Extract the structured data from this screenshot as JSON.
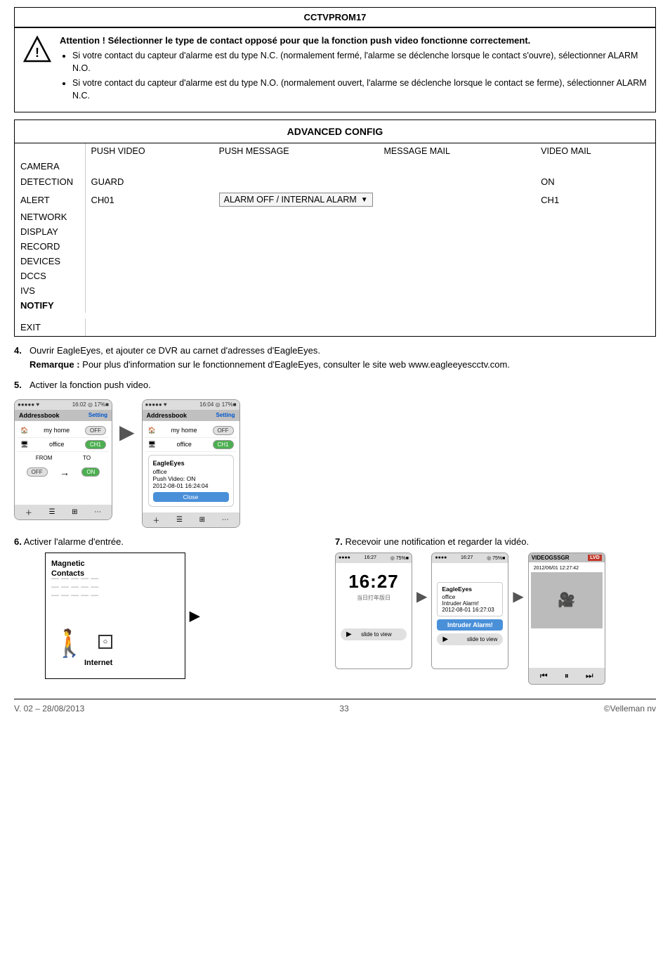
{
  "header": {
    "title": "CCTVPROM17"
  },
  "warning": {
    "title": "Attention ! Sélectionner le type de contact opposé pour que la fonction push video fonctionne correctement.",
    "bullets": [
      "Si votre contact du capteur d'alarme est du type N.C. (normalement fermé, l'alarme se déclenche lorsque le contact s'ouvre), sélectionner ALARM N.O.",
      "Si votre contact du capteur d'alarme est du type N.O. (normalement ouvert, l'alarme se déclenche lorsque le contact se ferme), sélectionner ALARM N.C."
    ]
  },
  "config": {
    "title": "ADVANCED CONFIG",
    "sidebar": [
      {
        "label": "CAMERA",
        "bold": false
      },
      {
        "label": "DETECTION",
        "bold": false
      },
      {
        "label": "ALERT",
        "bold": false
      },
      {
        "label": "NETWORK",
        "bold": false
      },
      {
        "label": "DISPLAY",
        "bold": false
      },
      {
        "label": "RECORD",
        "bold": false
      },
      {
        "label": "DEVICES",
        "bold": false
      },
      {
        "label": "DCCS",
        "bold": false
      },
      {
        "label": "IVS",
        "bold": false
      },
      {
        "label": "NOTIFY",
        "bold": true
      }
    ],
    "columns": [
      "PUSH VIDEO",
      "PUSH MESSAGE",
      "MESSAGE MAIL",
      "VIDEO MAIL"
    ],
    "guard_label": "GUARD",
    "guard_on": "ON",
    "ch01_label": "CH01",
    "alarm_select": "ALARM OFF / INTERNAL ALARM",
    "ch1_label": "CH1",
    "exit_label": "EXIT"
  },
  "steps": {
    "step4": {
      "num": "4.",
      "text": "Ouvrir EagleEyes, et ajouter ce DVR au carnet d'adresses d'EagleEyes.",
      "remark_label": "Remarque :",
      "remark_text": "Pour plus d'information sur le fonctionnement d'EagleEyes, consulter le site web www.eagleeyescctv.com."
    },
    "step5": {
      "num": "5.",
      "text": "Activer la fonction push video."
    }
  },
  "phones_step5": {
    "phone1": {
      "status_left": "●●●●● ♥",
      "status_right": "16:02  ◎ 17%■",
      "nav_title": "Addressbook",
      "nav_btn": "Setting",
      "items": [
        {
          "icon": "🏠",
          "label": "my home",
          "toggle": "OFF",
          "toggle_state": "off"
        },
        {
          "icon": "🖥",
          "label": "office",
          "toggle": "CH1",
          "toggle_state": "on"
        }
      ],
      "from_label": "FROM",
      "to_label": "TO",
      "from_toggle": "OFF",
      "to_toggle": "ON"
    },
    "phone2": {
      "status_left": "●●●●● ♥",
      "status_right": "16:04  ◎ 17%■",
      "nav_title": "Addressbook",
      "nav_btn": "Setting",
      "items": [
        {
          "icon": "🏠",
          "label": "my home",
          "toggle": "OFF",
          "toggle_state": "off"
        },
        {
          "icon": "🖥",
          "label": "office",
          "toggle": "CH1",
          "toggle_state": "on"
        }
      ],
      "popup": {
        "title": "EagleEyes",
        "line1": "office",
        "line2": "Push Video: ON",
        "line3": "2012-08-01 16:24:04",
        "close_btn": "Close"
      }
    }
  },
  "step6": {
    "num": "6.",
    "text": "Activer l'alarme d'entrée.",
    "diagram": {
      "label": "Magnetic\nContacts",
      "internet": "Internet"
    }
  },
  "step7": {
    "num": "7.",
    "text": "Recevoir une notification et regarder la vidéo.",
    "phone1": {
      "time": "16:27",
      "date": "当日打年版日",
      "slide": "slide to view"
    },
    "phone2": {
      "notif_title": "EagleEyes",
      "notif_line1": "office",
      "notif_line2": "Intruder Alarm!",
      "notif_line3": "2012-08-01 16:27:03",
      "alarm_btn": "Intruder Alarm!",
      "slide": "slide to view"
    },
    "phone3": {
      "header": "VIDEOGSSGR",
      "sub": "LVD",
      "date": "2012/06/01 12:27:42"
    }
  },
  "footer": {
    "version": "V. 02 – 28/08/2013",
    "page": "33",
    "copyright": "©Velleman nv"
  }
}
